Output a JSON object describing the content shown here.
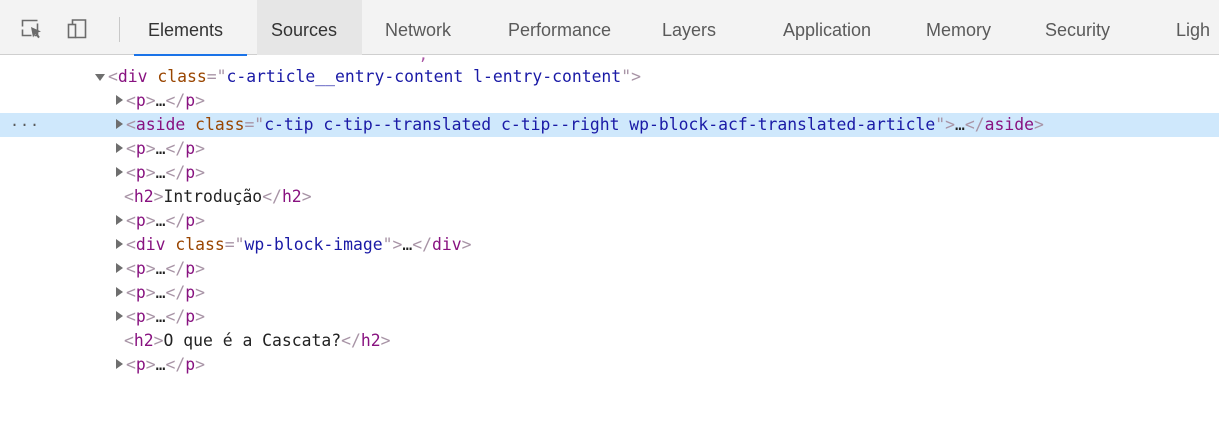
{
  "toolbar": {
    "tools": [
      {
        "name": "inspect-icon"
      },
      {
        "name": "device-toolbar-icon"
      }
    ],
    "tabs": [
      {
        "label": "Elements",
        "selected": true
      },
      {
        "label": "Sources",
        "hovered": true
      },
      {
        "label": "Network"
      },
      {
        "label": "Performance"
      },
      {
        "label": "Layers"
      },
      {
        "label": "Application"
      },
      {
        "label": "Memory"
      },
      {
        "label": "Security"
      },
      {
        "label": "Ligh"
      }
    ]
  },
  "tree": {
    "parent": {
      "tag": "div",
      "attr_name": "class",
      "attr_value": "c-article__entry-content l-entry-content"
    },
    "children": [
      {
        "type": "collapsed",
        "tag": "p"
      },
      {
        "type": "collapsed",
        "tag": "aside",
        "attr_name": "class",
        "attr_value": "c-tip c-tip--translated c-tip--right wp-block-acf-translated-article",
        "selected": true
      },
      {
        "type": "collapsed",
        "tag": "p"
      },
      {
        "type": "collapsed",
        "tag": "p"
      },
      {
        "type": "text",
        "tag": "h2",
        "text": "Introdução"
      },
      {
        "type": "collapsed",
        "tag": "p"
      },
      {
        "type": "collapsed",
        "tag": "div",
        "attr_name": "class",
        "attr_value": "wp-block-image"
      },
      {
        "type": "collapsed",
        "tag": "p"
      },
      {
        "type": "collapsed",
        "tag": "p"
      },
      {
        "type": "collapsed",
        "tag": "p"
      },
      {
        "type": "text",
        "tag": "h2",
        "text": "O que é a Cascata?"
      },
      {
        "type": "collapsed",
        "tag": "p"
      }
    ],
    "ellipsis": "…",
    "row_menu": "···"
  },
  "colors": {
    "tag": "#881280",
    "attr_name": "#994500",
    "attr_value": "#1a1aa6",
    "punctuation": "#a894a6",
    "selection": "#cfe8fc",
    "tab_underline": "#1a73e8"
  }
}
